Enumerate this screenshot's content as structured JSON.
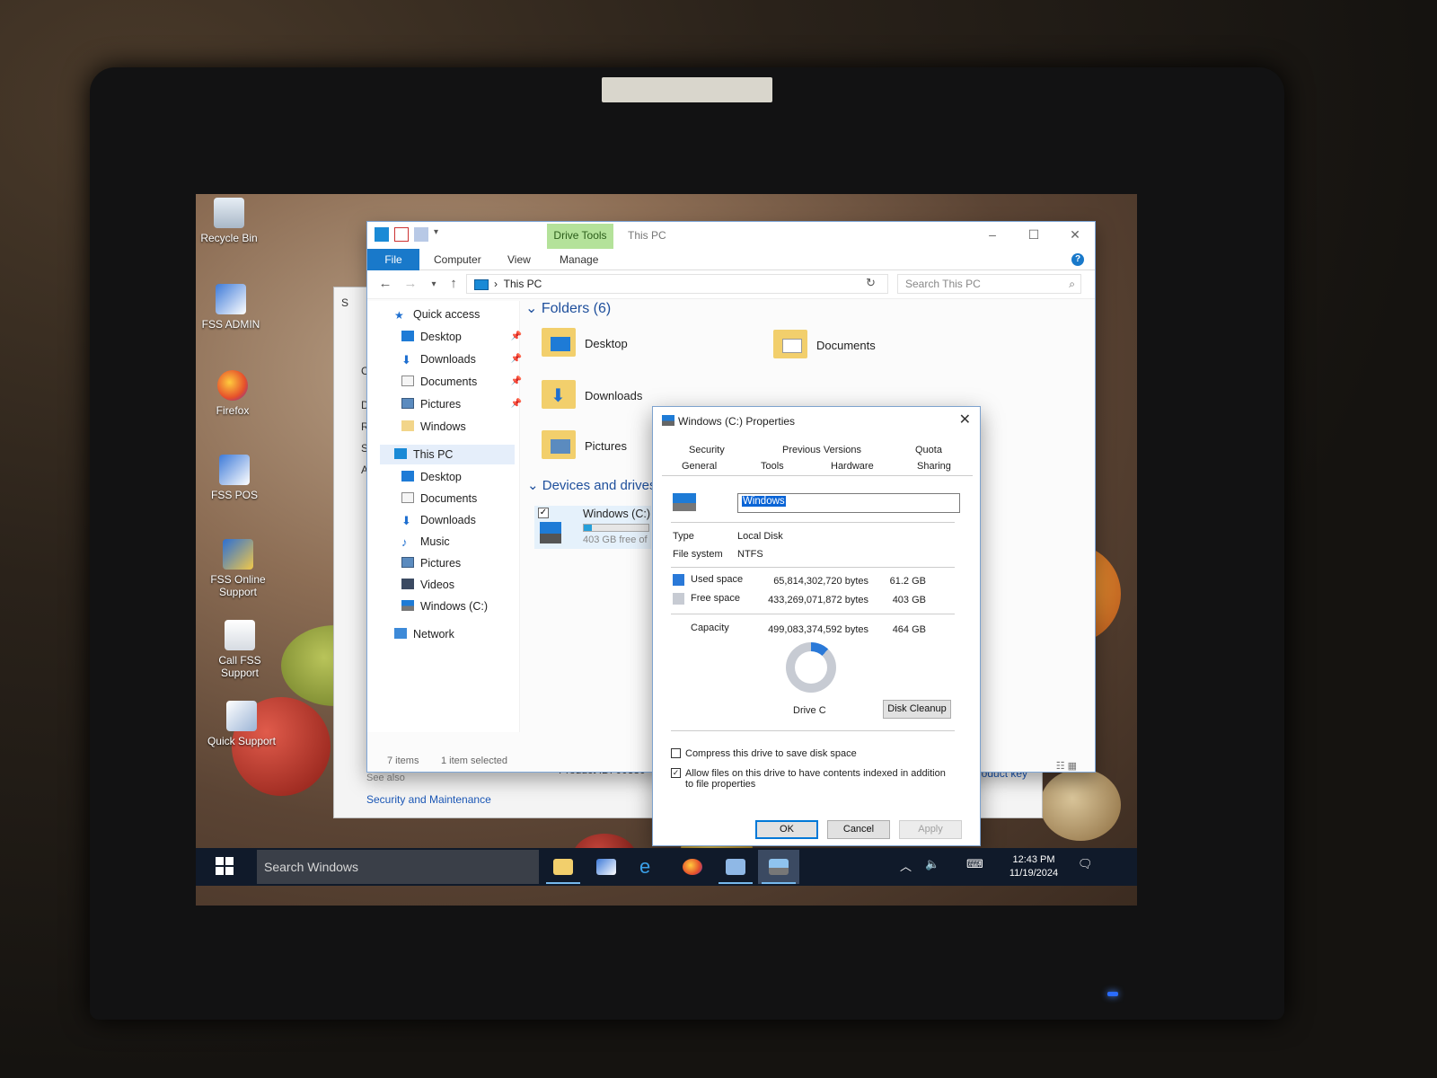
{
  "desktop": {
    "icons": [
      {
        "label": "Recycle Bin"
      },
      {
        "label": "FSS ADMIN"
      },
      {
        "label": "Firefox"
      },
      {
        "label": "FSS POS"
      },
      {
        "label": "FSS Online Support"
      },
      {
        "label": "Call FSS Support"
      },
      {
        "label": "Quick Support"
      }
    ]
  },
  "system_window": {
    "side_letters": [
      "S",
      "C",
      "D",
      "R",
      "S",
      "A"
    ],
    "see_also": "See also",
    "security_link": "Security and Maintenance",
    "product_id": "Product ID: 00380-",
    "product_key_link": "product key"
  },
  "explorer": {
    "title": "This PC",
    "contextual_tab": "Drive Tools",
    "tabs": {
      "file": "File",
      "computer": "Computer",
      "view": "View",
      "manage": "Manage"
    },
    "address": "This PC",
    "search_placeholder": "Search This PC",
    "nav": {
      "quick_access": "Quick access",
      "qa_items": [
        "Desktop",
        "Downloads",
        "Documents",
        "Pictures",
        "Windows"
      ],
      "this_pc": "This PC",
      "pc_items": [
        "Desktop",
        "Documents",
        "Downloads",
        "Music",
        "Pictures",
        "Videos",
        "Windows (C:)"
      ],
      "network": "Network"
    },
    "folders_header": "Folders (6)",
    "folders": [
      "Desktop",
      "Documents",
      "Downloads",
      "Pictures"
    ],
    "devices_header": "Devices and drives",
    "drive": {
      "name": "Windows (C:)",
      "free_text": "403 GB free of",
      "used_fraction": 0.13
    },
    "status": {
      "items": "7 items",
      "selected": "1 item selected"
    }
  },
  "properties": {
    "title": "Windows (C:) Properties",
    "tabs_row1": [
      "Security",
      "Previous Versions",
      "Quota"
    ],
    "tabs_row2": [
      "General",
      "Tools",
      "Hardware",
      "Sharing"
    ],
    "volume_name": "Windows",
    "type_label": "Type",
    "type_value": "Local Disk",
    "fs_label": "File system",
    "fs_value": "NTFS",
    "used_label": "Used space",
    "used_bytes": "65,814,302,720 bytes",
    "used_gb": "61.2 GB",
    "free_label": "Free space",
    "free_bytes": "433,269,071,872 bytes",
    "free_gb": "403 GB",
    "capacity_label": "Capacity",
    "capacity_bytes": "499,083,374,592 bytes",
    "capacity_gb": "464 GB",
    "drive_label": "Drive C",
    "disk_cleanup": "Disk Cleanup",
    "compress_label": "Compress this drive to save disk space",
    "index_label": "Allow files on this drive to have contents indexed in addition to file properties",
    "ok": "OK",
    "cancel": "Cancel",
    "apply": "Apply",
    "colors": {
      "used": "#2a79d8",
      "free": "#c7cbd3"
    }
  },
  "taskbar": {
    "search": "Search Windows",
    "time": "12:43 PM",
    "date": "11/19/2024"
  }
}
